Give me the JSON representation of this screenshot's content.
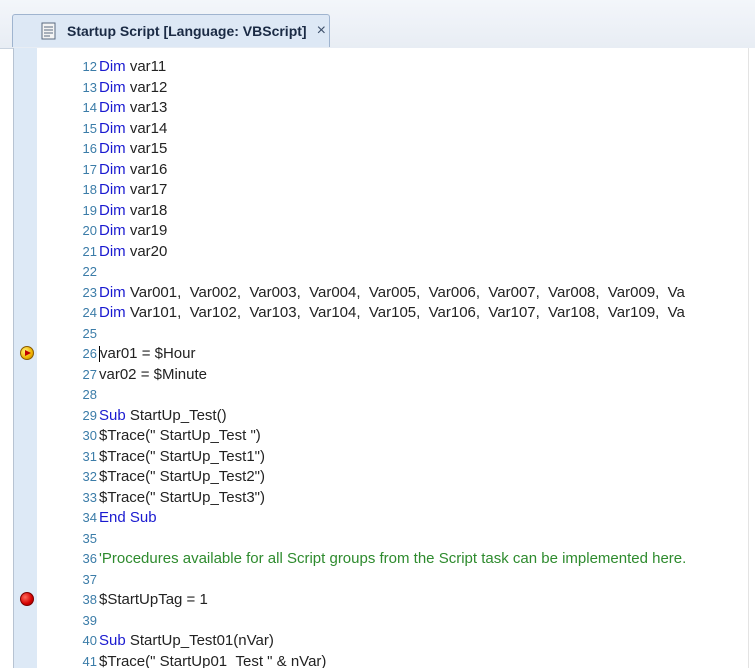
{
  "tab": {
    "icon": "script-document-icon",
    "title": "Startup Script [Language: VBScript]",
    "close": "×"
  },
  "editor": {
    "lines": [
      {
        "num": "12",
        "parts": [
          {
            "t": "Dim",
            "k": "kw"
          },
          {
            "t": " var11",
            "k": ""
          }
        ]
      },
      {
        "num": "13",
        "parts": [
          {
            "t": "Dim",
            "k": "kw"
          },
          {
            "t": " var12",
            "k": ""
          }
        ]
      },
      {
        "num": "14",
        "parts": [
          {
            "t": "Dim",
            "k": "kw"
          },
          {
            "t": " var13",
            "k": ""
          }
        ]
      },
      {
        "num": "15",
        "parts": [
          {
            "t": "Dim",
            "k": "kw"
          },
          {
            "t": " var14",
            "k": ""
          }
        ]
      },
      {
        "num": "16",
        "parts": [
          {
            "t": "Dim",
            "k": "kw"
          },
          {
            "t": " var15",
            "k": ""
          }
        ]
      },
      {
        "num": "17",
        "parts": [
          {
            "t": "Dim",
            "k": "kw"
          },
          {
            "t": " var16",
            "k": ""
          }
        ]
      },
      {
        "num": "18",
        "parts": [
          {
            "t": "Dim",
            "k": "kw"
          },
          {
            "t": " var17",
            "k": ""
          }
        ]
      },
      {
        "num": "19",
        "parts": [
          {
            "t": "Dim",
            "k": "kw"
          },
          {
            "t": " var18",
            "k": ""
          }
        ]
      },
      {
        "num": "20",
        "parts": [
          {
            "t": "Dim",
            "k": "kw"
          },
          {
            "t": " var19",
            "k": ""
          }
        ]
      },
      {
        "num": "21",
        "parts": [
          {
            "t": "Dim",
            "k": "kw"
          },
          {
            "t": " var20",
            "k": ""
          }
        ]
      },
      {
        "num": "22",
        "parts": []
      },
      {
        "num": "23",
        "parts": [
          {
            "t": "Dim",
            "k": "kw"
          },
          {
            "t": " Var001,  Var002,  Var003,  Var004,  Var005,  Var006,  Var007,  Var008,  Var009,  Va",
            "k": ""
          }
        ]
      },
      {
        "num": "24",
        "parts": [
          {
            "t": "Dim",
            "k": "kw"
          },
          {
            "t": " Var101,  Var102,  Var103,  Var104,  Var105,  Var106,  Var107,  Var108,  Var109,  Va",
            "k": ""
          }
        ]
      },
      {
        "num": "25",
        "parts": []
      },
      {
        "num": "26",
        "marker": "current",
        "caret": true,
        "parts": [
          {
            "t": "var01 = $Hour",
            "k": ""
          }
        ]
      },
      {
        "num": "27",
        "parts": [
          {
            "t": "var02 = $Minute",
            "k": ""
          }
        ]
      },
      {
        "num": "28",
        "parts": []
      },
      {
        "num": "29",
        "parts": [
          {
            "t": "Sub",
            "k": "kw"
          },
          {
            "t": " StartUp_Test()",
            "k": ""
          }
        ]
      },
      {
        "num": "30",
        "parts": [
          {
            "t": "$Trace(\" StartUp_Test \")",
            "k": ""
          }
        ]
      },
      {
        "num": "31",
        "parts": [
          {
            "t": "$Trace(\" StartUp_Test1\")",
            "k": ""
          }
        ]
      },
      {
        "num": "32",
        "parts": [
          {
            "t": "$Trace(\" StartUp_Test2\")",
            "k": ""
          }
        ]
      },
      {
        "num": "33",
        "parts": [
          {
            "t": "$Trace(\" StartUp_Test3\")",
            "k": ""
          }
        ]
      },
      {
        "num": "34",
        "parts": [
          {
            "t": "End Sub",
            "k": "kw"
          }
        ]
      },
      {
        "num": "35",
        "parts": []
      },
      {
        "num": "36",
        "parts": [
          {
            "t": "'Procedures available for all Script groups from the Script task can be implemented here.",
            "k": "cm"
          }
        ]
      },
      {
        "num": "37",
        "parts": []
      },
      {
        "num": "38",
        "marker": "breakpoint",
        "parts": [
          {
            "t": "$StartUpTag = 1",
            "k": ""
          }
        ]
      },
      {
        "num": "39",
        "parts": []
      },
      {
        "num": "40",
        "parts": [
          {
            "t": "Sub",
            "k": "kw"
          },
          {
            "t": " StartUp_Test01(nVar)",
            "k": ""
          }
        ]
      },
      {
        "num": "41",
        "parts": [
          {
            "t": "$Trace(\" StartUp01_Test \" & nVar)",
            "k": ""
          }
        ]
      }
    ]
  },
  "colors": {
    "keyword": "#1a1ad0",
    "comment": "#2e8b2e",
    "line_number": "#3b7ca8",
    "gutter": "#dde9f6"
  }
}
